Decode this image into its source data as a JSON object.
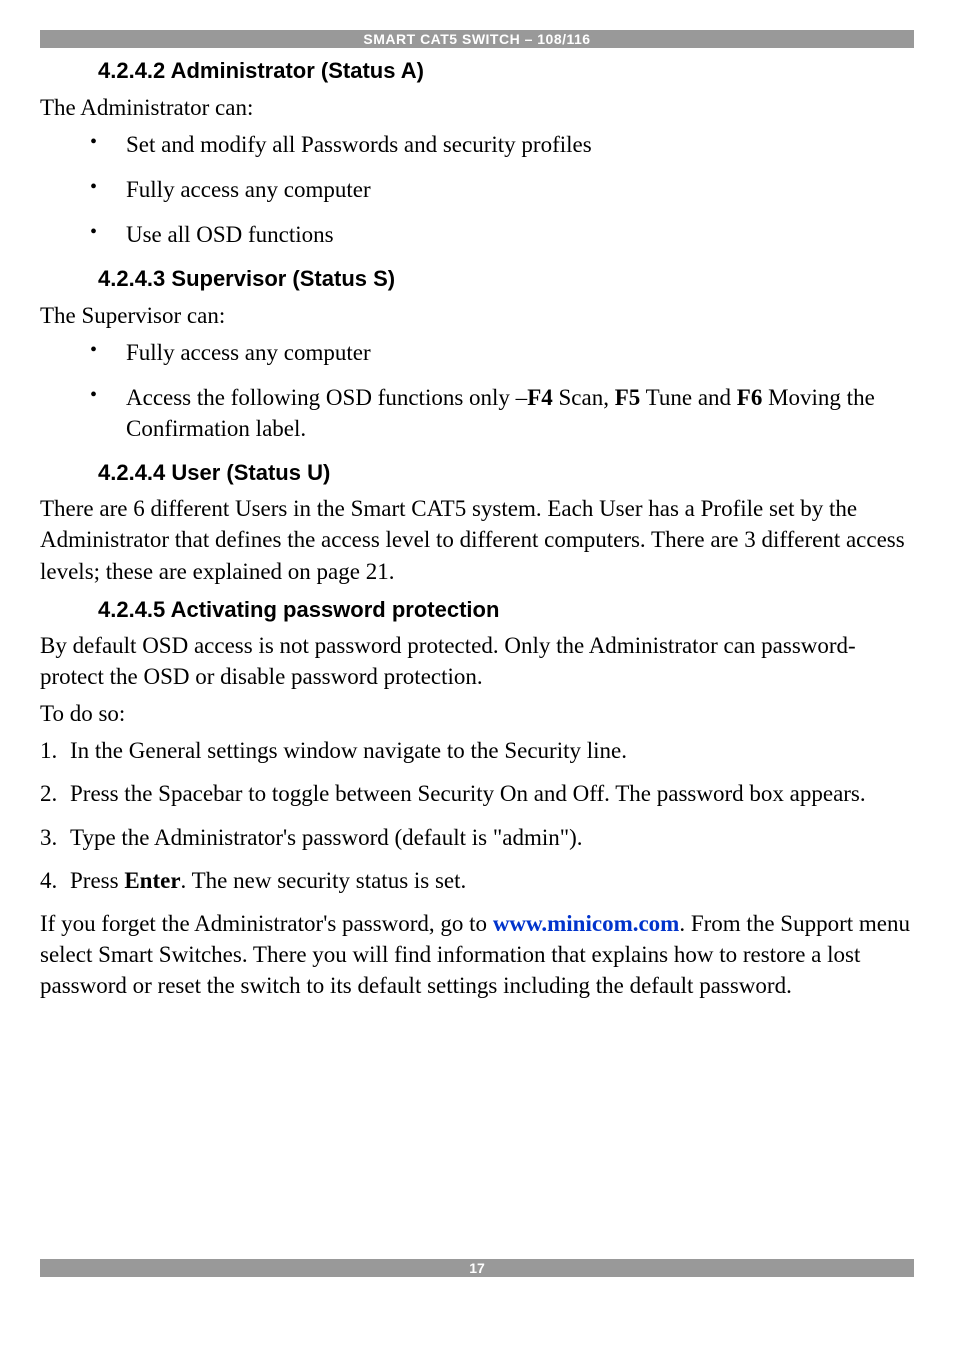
{
  "header": "SMART CAT5 SWITCH – 108/116",
  "page_number": "17",
  "sections": {
    "s1": {
      "heading": "4.2.4.2 Administrator (Status A)",
      "intro": "The Administrator can:"
    },
    "s1_bullets": [
      "Set and modify all Passwords and security profiles",
      "Fully access any computer",
      "Use all OSD functions"
    ],
    "s2": {
      "heading": "4.2.4.3 Supervisor (Status S)",
      "intro": "The Supervisor can:"
    },
    "s2_bullet1": "Fully access any computer",
    "s2_bullet2_pre": "Access the following OSD functions only –",
    "s2_bullet2_f4": "F4",
    "s2_bullet2_mid1": " Scan, ",
    "s2_bullet2_f5": "F5",
    "s2_bullet2_mid2": " Tune and ",
    "s2_bullet2_f6": "F6",
    "s2_bullet2_post": " Moving the Confirmation label.",
    "s3": {
      "heading": "4.2.4.4 User (Status U)",
      "para": "There are 6 different Users in the Smart CAT5 system. Each User has a Profile set by the Administrator that defines the access level to different computers. There are 3 different access levels; these are explained on page 21."
    },
    "s4": {
      "heading": "4.2.4.5 Activating password protection",
      "para1": "By default OSD access is not password protected. Only the Administrator can password-protect the OSD or disable password protection.",
      "todo": "To do so:"
    },
    "steps": {
      "st1": "In the General settings window navigate to the Security line.",
      "st2": "Press the Spacebar to toggle between Security On and Off. The password box appears.",
      "st3": "Type the Administrator's password (default is \"admin\").",
      "st4_pre": "Press ",
      "st4_bold": "Enter",
      "st4_post": ". The new security status is set."
    },
    "final": {
      "pre": "If you forget the Administrator's password, go to ",
      "link": "www.minicom.com",
      "post": ". From the Support menu select Smart Switches. There you will find information that explains how to restore a lost password or reset the switch to its default settings including the default password."
    }
  }
}
